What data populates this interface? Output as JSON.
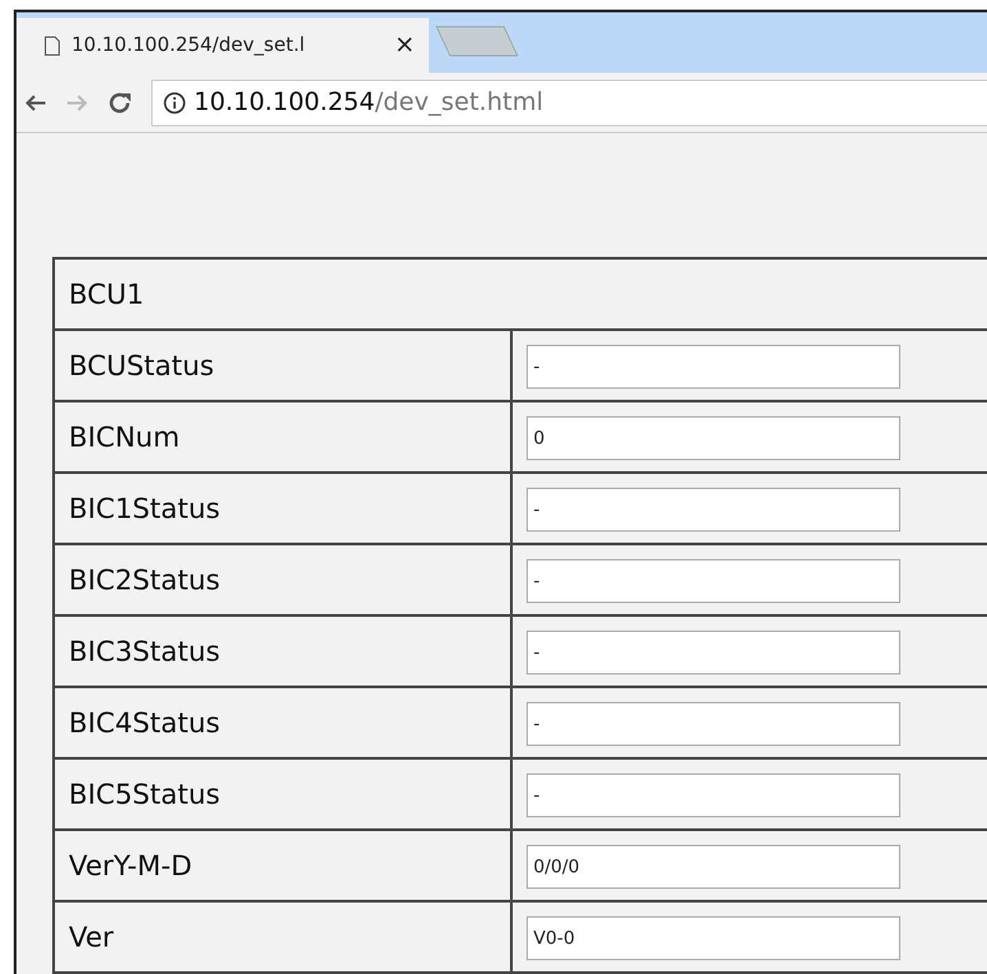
{
  "tab": {
    "title": "10.10.100.254/dev_set.l",
    "close": "×"
  },
  "address": {
    "host": "10.10.100.254",
    "path": "/dev_set.html"
  },
  "table": {
    "title": "BCU1",
    "rows": [
      {
        "label": "BCUStatus",
        "value": "-"
      },
      {
        "label": "BICNum",
        "value": "0"
      },
      {
        "label": "BIC1Status",
        "value": "-"
      },
      {
        "label": "BIC2Status",
        "value": "-"
      },
      {
        "label": "BIC3Status",
        "value": "-"
      },
      {
        "label": "BIC4Status",
        "value": "-"
      },
      {
        "label": "BIC5Status",
        "value": "-"
      },
      {
        "label": "VerY-M-D",
        "value": "0/0/0"
      },
      {
        "label": "Ver",
        "value": "V0-0"
      }
    ]
  }
}
